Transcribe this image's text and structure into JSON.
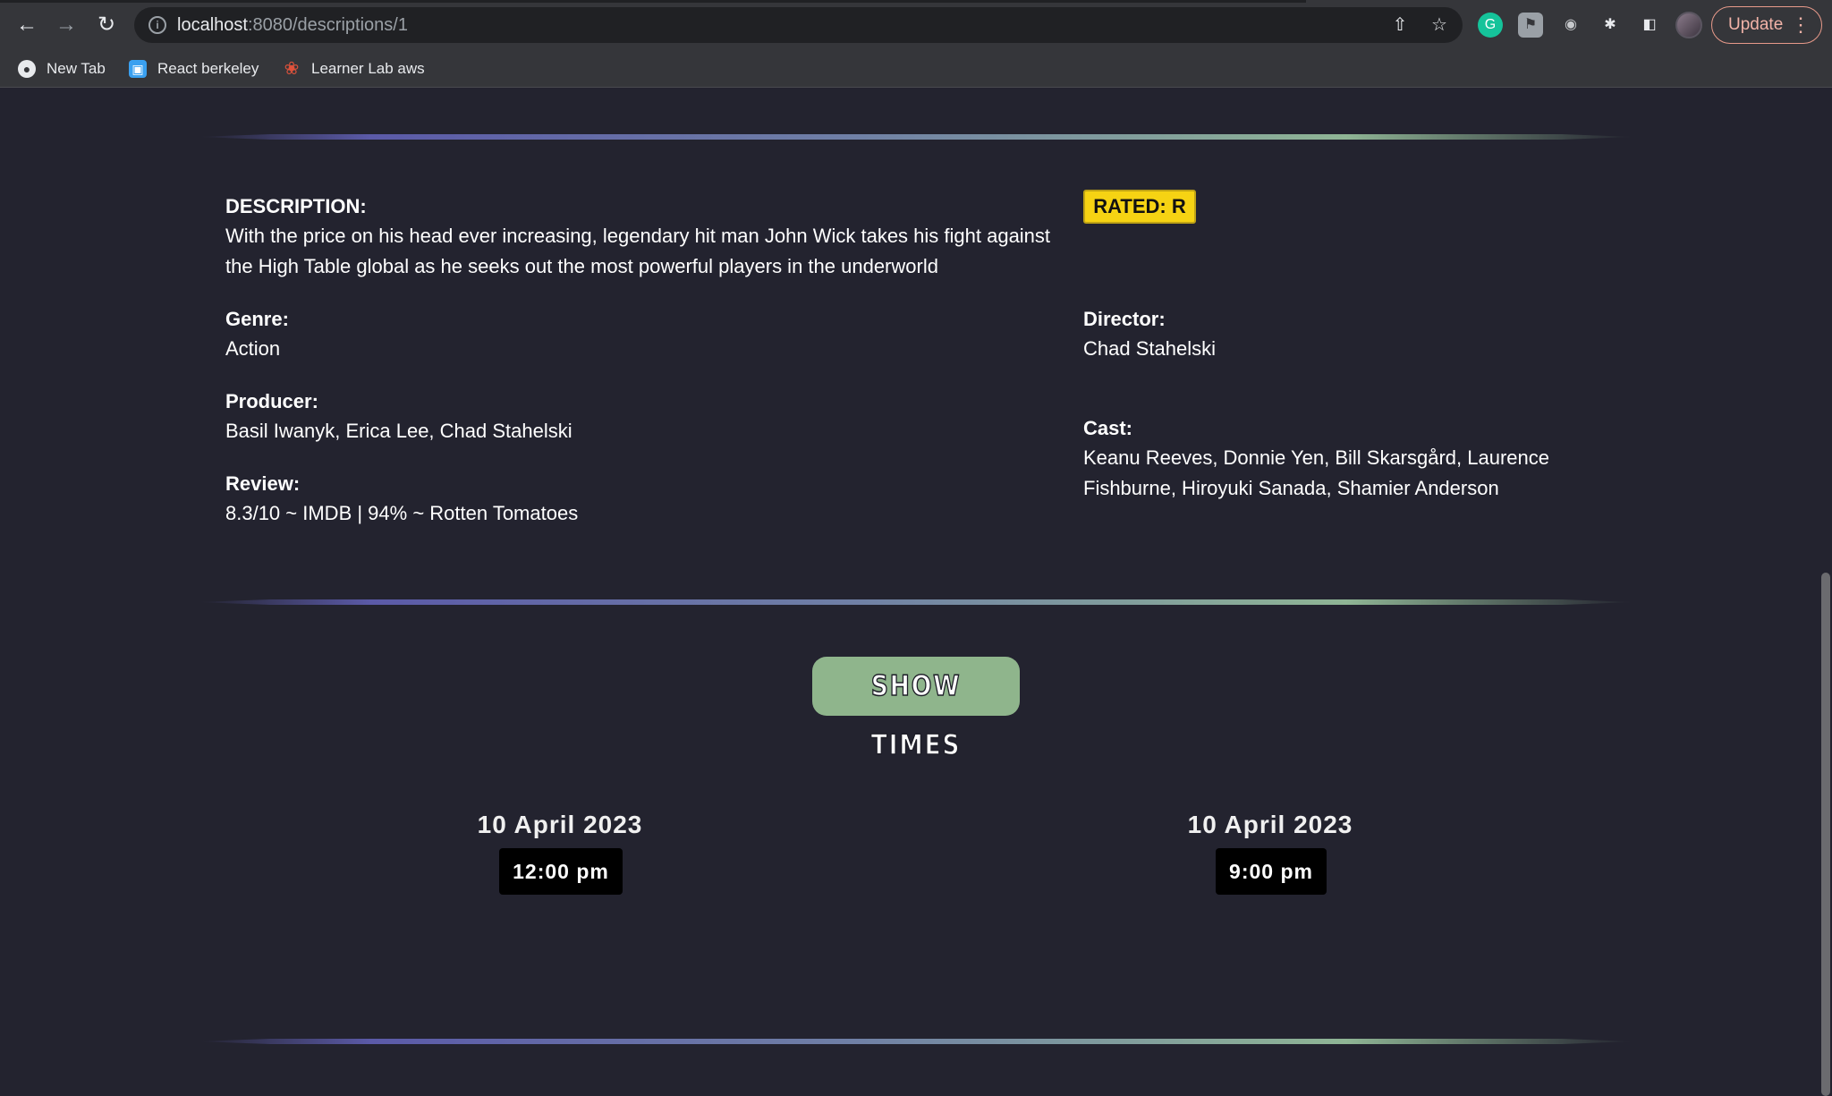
{
  "browser": {
    "url_host": "localhost",
    "url_path": ":8080/descriptions/1",
    "update_label": "Update",
    "bookmarks": [
      {
        "label": "New Tab",
        "icon": "globe-icon"
      },
      {
        "label": "React berkeley",
        "icon": "monitor-icon"
      },
      {
        "label": "Learner Lab aws",
        "icon": "aws-logo-icon"
      }
    ]
  },
  "details": {
    "description_label": "DESCRIPTION:",
    "description_line1": "With the price on his head ever increasing, legendary hit man John Wick takes his fight against",
    "description_line2": "the High Table global as he seeks out the most powerful players in the underworld",
    "rating": "RATED: R",
    "genre_label": "Genre:",
    "genre": "Action",
    "director_label": "Director:",
    "director": "Chad Stahelski",
    "producer_label": "Producer:",
    "producer": "Basil Iwanyk, Erica Lee, Chad Stahelski",
    "cast_label": "Cast:",
    "cast_line1": "Keanu Reeves, Donnie Yen, Bill Skarsgård, Laurence",
    "cast_line2": "Fishburne, Hiroyuki Sanada, Shamier Anderson",
    "review_label": "Review:",
    "review": "8.3/10 ~ IMDB | 94% ~ Rotten Tomatoes"
  },
  "showtimes": {
    "button_label": "SHOW TIMES",
    "items": [
      {
        "date": "10 April 2023",
        "time": "12:00 pm"
      },
      {
        "date": "10 April 2023",
        "time": "9:00 pm"
      }
    ]
  },
  "colors": {
    "page_bg": "#23232f",
    "rating_badge": "#f6d313",
    "showtimes_button": "#8fb58c"
  }
}
